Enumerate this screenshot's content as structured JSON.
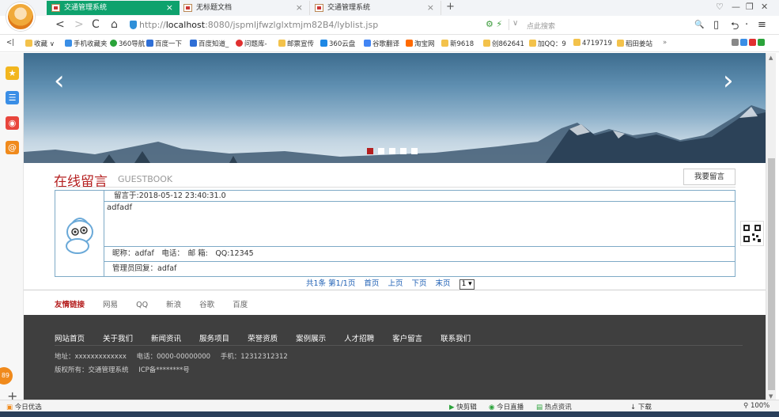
{
  "tabs": [
    {
      "title": "交通管理系统",
      "close": "×"
    },
    {
      "title": "无标题文档",
      "close": "×"
    },
    {
      "title": "交通管理系统",
      "close": "×"
    }
  ],
  "new_tab": "+",
  "window_controls": [
    "♡",
    "—",
    "❐",
    "✕"
  ],
  "address": {
    "back": "<",
    "forward": ">",
    "reload": "C",
    "home": "⌂",
    "url_prefix": "http://",
    "url_host": "localhost",
    "url_rest": ":8080/jspmljfwzlglxtmjm82B4/lyblist.jsp",
    "addr_icons": "⚙ ⚡",
    "dropdown": "∨",
    "search_placeholder": "点此搜索",
    "right_icons": [
      "🔍",
      "▯",
      "⮌",
      "·",
      "≡"
    ]
  },
  "bookmarks": [
    {
      "label": "<|",
      "color": "#fff"
    },
    {
      "label": "收藏 ∨",
      "color": "#f3c24b"
    },
    {
      "label": "手机收藏夹",
      "color": "#3a8ee6"
    },
    {
      "label": "360导航",
      "color": "#2aa33a"
    },
    {
      "label": "百度一下",
      "color": "#2f6fd6"
    },
    {
      "label": "百度知道_",
      "color": "#2f6fd6"
    },
    {
      "label": "问题库-",
      "color": "#e03030"
    },
    {
      "label": "邮票宣传",
      "color": "#f3c24b"
    },
    {
      "label": "360云盘",
      "color": "#1e88e5"
    },
    {
      "label": "谷歌翻译",
      "color": "#4285f4"
    },
    {
      "label": "淘宝网",
      "color": "#ff6a00"
    },
    {
      "label": "新9618",
      "color": "#f3c24b"
    },
    {
      "label": "创862641",
      "color": "#f3c24b"
    },
    {
      "label": "加QQ：9",
      "color": "#f3c24b"
    },
    {
      "label": "4719719",
      "color": "#f3c24b"
    },
    {
      "label": "稻田姜站",
      "color": "#f3c24b"
    },
    {
      "label": "»",
      "color": "#fff"
    }
  ],
  "sidebar": {
    "items": [
      {
        "icon": "★",
        "color": "#f2b61e"
      },
      {
        "icon": "☰",
        "color": "#3a8ee6"
      },
      {
        "icon": "◉",
        "color": "#e8453c"
      },
      {
        "icon": "@",
        "color": "#f08a1c"
      }
    ],
    "badge": "89",
    "add": "+"
  },
  "banner": {
    "prev": "‹",
    "next": "›",
    "slides": 5,
    "active": 0
  },
  "guestbook": {
    "title": "在线留言",
    "subtitle": "GUESTBOOK",
    "write_button": "我要留言",
    "messages": [
      {
        "time": "留言于:2018-05-12 23:40:31.0",
        "content": "adfadf",
        "info": "昵称：adfaf　电话：　邮 箱:　QQ:12345",
        "reply": "管理员回复：adfaf"
      }
    ]
  },
  "pager": {
    "summary": "共1条 第1/1页",
    "first": "首页",
    "prev": "上页",
    "next": "下页",
    "last": "末页",
    "select_value": "1 ▾"
  },
  "friend_links": {
    "label": "友情链接",
    "items": [
      "网易",
      "QQ",
      "新浪",
      "谷歌",
      "百度"
    ]
  },
  "footer": {
    "nav": [
      "网站首页",
      "关于我们",
      "新闻资讯",
      "服务项目",
      "荣誉资质",
      "案例展示",
      "人才招聘",
      "客户留言",
      "联系我们"
    ],
    "address": "地址：xxxxxxxxxxxxx",
    "phone": "电话：0000-00000000",
    "mobile": "手机：12312312312",
    "copyright": "版权所有：交通管理系统",
    "icp": "ICP备********号"
  },
  "statusbar": {
    "left": "今日优选",
    "items": [
      "快剪辑",
      "今日直播",
      "热点资讯"
    ],
    "download": "下载",
    "zoom": "100%"
  },
  "colors": {
    "accent": "#b51f1f",
    "tab_active": "#0ea26d",
    "footer_bg": "#3f3f3f",
    "link": "#1e5fb4",
    "table_border": "#7eaac6"
  }
}
